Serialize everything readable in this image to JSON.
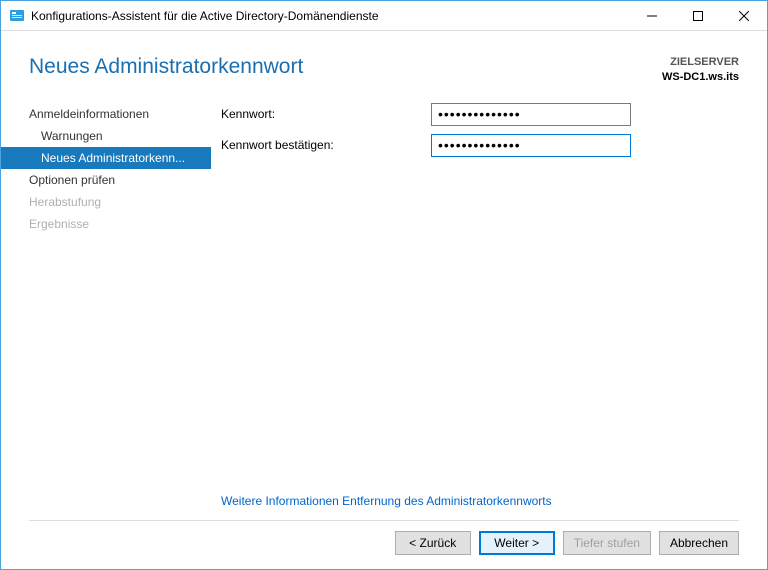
{
  "window": {
    "title": "Konfigurations-Assistent für die Active Directory-Domänendienste"
  },
  "header": {
    "page_title": "Neues Administratorkennwort",
    "target_label": "ZIELSERVER",
    "target_server": "WS-DC1.ws.its"
  },
  "sidebar": {
    "items": [
      {
        "label": "Anmeldeinformationen"
      },
      {
        "label": "Warnungen"
      },
      {
        "label": "Neues Administratorkenn..."
      },
      {
        "label": "Optionen prüfen"
      },
      {
        "label": "Herabstufung"
      },
      {
        "label": "Ergebnisse"
      }
    ]
  },
  "form": {
    "password_label": "Kennwort:",
    "confirm_label": "Kennwort bestätigen:",
    "password_value": "••••••••••••••",
    "confirm_value": "••••••••••••••"
  },
  "info_link": "Weitere Informationen Entfernung des Administratorkennworts",
  "footer": {
    "back": "< Zurück",
    "next": "Weiter >",
    "demote": "Tiefer stufen",
    "cancel": "Abbrechen"
  }
}
